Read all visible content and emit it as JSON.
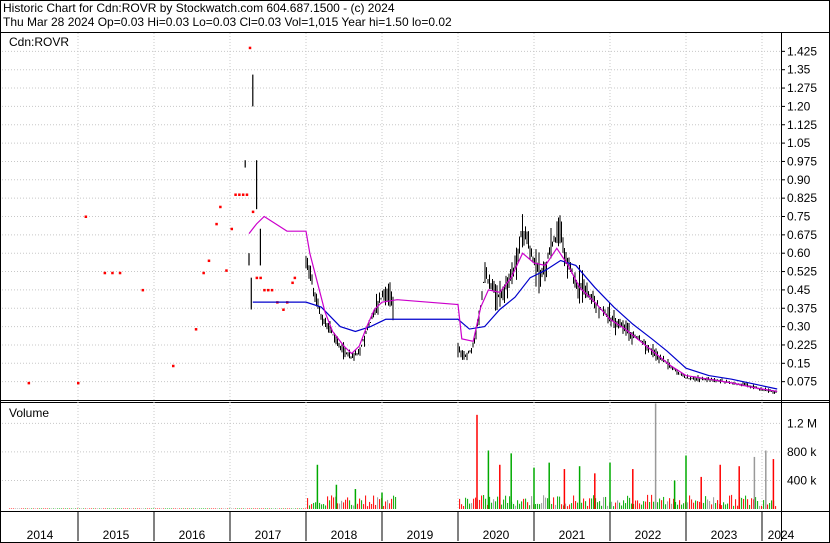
{
  "header": {
    "line1": "Historic Chart for Cdn:ROVR by Stockwatch.com 604.687.1500 - (c) 2024",
    "line2": "Thu Mar 28 2024  Op=0.03  Hi=0.03  Lo=0.03  Cl=0.03  Vol=1,015  Year hi=1.50  lo=0.02"
  },
  "colors": {
    "background": "#ffffff",
    "grid": "#c8c8c8",
    "price_bar": "#000000",
    "sparse_dot": "#ff0000",
    "ma_short": "#cc00cc",
    "ma_long": "#0000cc",
    "volume_up": "#00aa00",
    "volume_down": "#ff0000",
    "volume_flat": "#999999"
  },
  "chart_data": [
    {
      "type": "line",
      "panel": "price",
      "title": "Cdn:ROVR",
      "ylim": [
        0.0,
        1.5
      ],
      "yticks": [
        0.075,
        0.15,
        0.225,
        0.3,
        0.375,
        0.45,
        0.525,
        0.6,
        0.675,
        0.75,
        0.825,
        0.9,
        0.975,
        1.05,
        1.125,
        1.2,
        1.275,
        1.35,
        1.425
      ],
      "ytick_labels": [
        "0.075",
        "0.15",
        "0.225",
        "0.30",
        "0.375",
        "0.45",
        "0.525",
        "0.60",
        "0.675",
        "0.75",
        "0.825",
        "0.90",
        "0.975",
        "1.05",
        "1.125",
        "1.20",
        "1.275",
        "1.35",
        "1.425"
      ],
      "x_years": [
        "2014",
        "2015",
        "2016",
        "2017",
        "2018",
        "2019",
        "2020",
        "2021",
        "2022",
        "2023",
        "2024"
      ],
      "x_ticks": [
        2014.5,
        2015.5,
        2016.5,
        2017.5,
        2018.5,
        2019.5,
        2020.5,
        2021.5,
        2022.5,
        2023.5,
        2024.25
      ],
      "xlim": [
        2014.0,
        2024.25
      ],
      "sparse_points": [
        [
          2014.35,
          0.07
        ],
        [
          2015.0,
          0.07
        ],
        [
          2015.1,
          0.75
        ],
        [
          2015.35,
          0.52
        ],
        [
          2015.45,
          0.52
        ],
        [
          2015.55,
          0.52
        ],
        [
          2015.85,
          0.45
        ],
        [
          2016.25,
          0.14
        ],
        [
          2016.55,
          0.29
        ],
        [
          2016.65,
          0.52
        ],
        [
          2016.72,
          0.57
        ],
        [
          2016.82,
          0.72
        ],
        [
          2016.87,
          0.79
        ],
        [
          2016.95,
          0.53
        ],
        [
          2017.02,
          0.7
        ],
        [
          2017.07,
          0.84
        ],
        [
          2017.12,
          0.84
        ],
        [
          2017.17,
          0.84
        ],
        [
          2017.22,
          0.84
        ],
        [
          2017.3,
          0.77
        ],
        [
          2017.35,
          0.5
        ],
        [
          2017.4,
          0.5
        ],
        [
          2017.45,
          0.45
        ],
        [
          2017.5,
          0.45
        ],
        [
          2017.55,
          0.45
        ],
        [
          2017.62,
          0.4
        ],
        [
          2017.7,
          0.37
        ],
        [
          2017.75,
          0.4
        ],
        [
          2017.82,
          0.48
        ],
        [
          2017.85,
          0.5
        ],
        [
          2017.26,
          1.44
        ]
      ],
      "price_segments": [
        {
          "x_start": 2017.2,
          "x_end": 2017.5,
          "points": [
            [
              2017.2,
              0.95,
              0.98
            ],
            [
              2017.25,
              0.55,
              0.6
            ],
            [
              2017.28,
              0.37,
              0.5
            ],
            [
              2017.3,
              1.2,
              1.33
            ],
            [
              2017.35,
              0.78,
              0.98
            ],
            [
              2017.4,
              0.55,
              0.7
            ]
          ]
        },
        {
          "x_start": 2018.0,
          "x_end": 2019.15,
          "shape": [
            [
              2018.0,
              0.58
            ],
            [
              2018.1,
              0.45
            ],
            [
              2018.2,
              0.34
            ],
            [
              2018.3,
              0.3
            ],
            [
              2018.4,
              0.24
            ],
            [
              2018.5,
              0.2
            ],
            [
              2018.6,
              0.17
            ],
            [
              2018.7,
              0.2
            ],
            [
              2018.8,
              0.28
            ],
            [
              2018.9,
              0.36
            ],
            [
              2019.0,
              0.42
            ],
            [
              2019.1,
              0.44
            ],
            [
              2019.15,
              0.38
            ]
          ]
        },
        {
          "x_start": 2020.0,
          "x_end": 2024.2,
          "shape": [
            [
              2020.0,
              0.2
            ],
            [
              2020.1,
              0.18
            ],
            [
              2020.2,
              0.22
            ],
            [
              2020.3,
              0.38
            ],
            [
              2020.35,
              0.52
            ],
            [
              2020.45,
              0.46
            ],
            [
              2020.55,
              0.42
            ],
            [
              2020.65,
              0.47
            ],
            [
              2020.75,
              0.55
            ],
            [
              2020.85,
              0.7
            ],
            [
              2020.95,
              0.62
            ],
            [
              2021.05,
              0.52
            ],
            [
              2021.15,
              0.55
            ],
            [
              2021.25,
              0.65
            ],
            [
              2021.35,
              0.68
            ],
            [
              2021.45,
              0.55
            ],
            [
              2021.55,
              0.48
            ],
            [
              2021.7,
              0.44
            ],
            [
              2021.85,
              0.38
            ],
            [
              2022.0,
              0.34
            ],
            [
              2022.15,
              0.3
            ],
            [
              2022.3,
              0.27
            ],
            [
              2022.45,
              0.23
            ],
            [
              2022.6,
              0.19
            ],
            [
              2022.75,
              0.15
            ],
            [
              2022.9,
              0.11
            ],
            [
              2023.0,
              0.09
            ],
            [
              2023.2,
              0.085
            ],
            [
              2023.4,
              0.08
            ],
            [
              2023.6,
              0.07
            ],
            [
              2023.8,
              0.06
            ],
            [
              2024.0,
              0.045
            ],
            [
              2024.2,
              0.03
            ]
          ]
        }
      ],
      "ma_short": [
        [
          2017.25,
          0.68
        ],
        [
          2017.35,
          0.72
        ],
        [
          2017.45,
          0.75
        ],
        [
          2017.55,
          0.73
        ],
        [
          2017.65,
          0.71
        ],
        [
          2017.75,
          0.69
        ],
        [
          2018.0,
          0.69
        ],
        [
          2018.05,
          0.6
        ],
        [
          2018.15,
          0.48
        ],
        [
          2018.25,
          0.36
        ],
        [
          2018.35,
          0.28
        ],
        [
          2018.5,
          0.22
        ],
        [
          2018.6,
          0.19
        ],
        [
          2018.7,
          0.22
        ],
        [
          2018.8,
          0.3
        ],
        [
          2018.9,
          0.37
        ],
        [
          2019.0,
          0.4
        ],
        [
          2019.2,
          0.41
        ],
        [
          2020.0,
          0.39
        ],
        [
          2020.05,
          0.25
        ],
        [
          2020.2,
          0.24
        ],
        [
          2020.3,
          0.38
        ],
        [
          2020.4,
          0.45
        ],
        [
          2020.55,
          0.44
        ],
        [
          2020.7,
          0.5
        ],
        [
          2020.85,
          0.6
        ],
        [
          2021.0,
          0.56
        ],
        [
          2021.15,
          0.55
        ],
        [
          2021.3,
          0.62
        ],
        [
          2021.45,
          0.55
        ],
        [
          2021.6,
          0.46
        ],
        [
          2021.8,
          0.4
        ],
        [
          2022.0,
          0.33
        ],
        [
          2022.2,
          0.29
        ],
        [
          2022.4,
          0.24
        ],
        [
          2022.6,
          0.19
        ],
        [
          2022.8,
          0.14
        ],
        [
          2023.0,
          0.1
        ],
        [
          2023.3,
          0.085
        ],
        [
          2023.6,
          0.07
        ],
        [
          2023.9,
          0.05
        ],
        [
          2024.2,
          0.035
        ]
      ],
      "ma_long": [
        [
          2017.3,
          0.4
        ],
        [
          2017.35,
          0.4
        ],
        [
          2018.0,
          0.4
        ],
        [
          2018.2,
          0.38
        ],
        [
          2018.45,
          0.3
        ],
        [
          2018.65,
          0.28
        ],
        [
          2018.85,
          0.3
        ],
        [
          2019.05,
          0.33
        ],
        [
          2020.0,
          0.33
        ],
        [
          2020.15,
          0.29
        ],
        [
          2020.35,
          0.3
        ],
        [
          2020.55,
          0.37
        ],
        [
          2020.75,
          0.42
        ],
        [
          2020.95,
          0.5
        ],
        [
          2021.15,
          0.53
        ],
        [
          2021.35,
          0.57
        ],
        [
          2021.55,
          0.55
        ],
        [
          2021.8,
          0.46
        ],
        [
          2022.05,
          0.38
        ],
        [
          2022.3,
          0.31
        ],
        [
          2022.55,
          0.25
        ],
        [
          2022.75,
          0.2
        ],
        [
          2023.0,
          0.13
        ],
        [
          2023.3,
          0.1
        ],
        [
          2023.6,
          0.085
        ],
        [
          2023.9,
          0.065
        ],
        [
          2024.2,
          0.045
        ]
      ]
    },
    {
      "type": "bar",
      "panel": "volume",
      "title": "Volume",
      "ylim": [
        0,
        1500000
      ],
      "yticks": [
        400000,
        800000,
        1200000
      ],
      "ytick_labels": [
        "400 k",
        "800 k",
        "1.2 M"
      ],
      "spikes": [
        [
          2018.15,
          620000,
          "up"
        ],
        [
          2018.4,
          340000,
          "up"
        ],
        [
          2018.65,
          280000,
          "up"
        ],
        [
          2019.0,
          230000,
          "up"
        ],
        [
          2020.25,
          1320000,
          "down"
        ],
        [
          2020.4,
          820000,
          "up"
        ],
        [
          2020.55,
          620000,
          "down"
        ],
        [
          2020.7,
          780000,
          "up"
        ],
        [
          2021.0,
          580000,
          "up"
        ],
        [
          2021.2,
          650000,
          "up"
        ],
        [
          2021.4,
          560000,
          "down"
        ],
        [
          2021.6,
          600000,
          "up"
        ],
        [
          2021.8,
          500000,
          "down"
        ],
        [
          2022.0,
          650000,
          "up"
        ],
        [
          2022.3,
          560000,
          "down"
        ],
        [
          2022.6,
          1480000,
          "flat"
        ],
        [
          2022.85,
          400000,
          "up"
        ],
        [
          2023.0,
          750000,
          "up"
        ],
        [
          2023.2,
          450000,
          "down"
        ],
        [
          2023.45,
          620000,
          "down"
        ],
        [
          2023.7,
          600000,
          "down"
        ],
        [
          2023.9,
          730000,
          "flat"
        ],
        [
          2024.05,
          820000,
          "flat"
        ],
        [
          2024.15,
          700000,
          "down"
        ]
      ]
    }
  ]
}
